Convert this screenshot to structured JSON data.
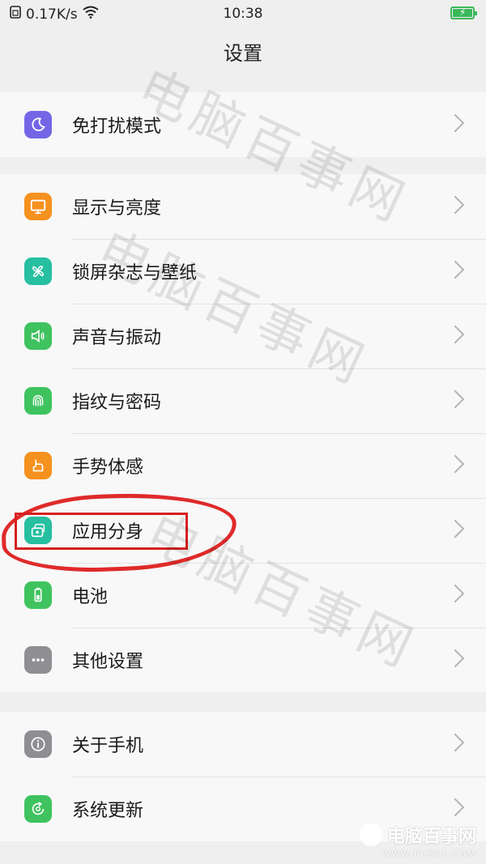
{
  "status_bar": {
    "network_speed": "0.17K/s",
    "time": "10:38"
  },
  "header": {
    "title": "设置"
  },
  "groups": [
    {
      "items": [
        {
          "label": "免打扰模式",
          "icon": "moon-icon",
          "color": "#7266e6"
        }
      ]
    },
    {
      "items": [
        {
          "label": "显示与亮度",
          "icon": "display-icon",
          "color": "#f5911f"
        },
        {
          "label": "锁屏杂志与壁纸",
          "icon": "pinwheel-icon",
          "color": "#26bfa0"
        },
        {
          "label": "声音与振动",
          "icon": "speaker-icon",
          "color": "#3fc35f"
        },
        {
          "label": "指纹与密码",
          "icon": "fingerprint-icon",
          "color": "#3fc35f"
        },
        {
          "label": "手势体感",
          "icon": "gesture-hand-icon",
          "color": "#f5911f"
        },
        {
          "label": "应用分身",
          "icon": "app-clone-icon",
          "color": "#26bfa0"
        },
        {
          "label": "电池",
          "icon": "battery-icon",
          "color": "#3fc35f"
        },
        {
          "label": "其他设置",
          "icon": "more-dots-icon",
          "color": "#8e8e93"
        }
      ]
    },
    {
      "items": [
        {
          "label": "关于手机",
          "icon": "info-icon",
          "color": "#8e8e93"
        },
        {
          "label": "系统更新",
          "icon": "update-icon",
          "color": "#3fc35f"
        }
      ]
    }
  ],
  "watermark": {
    "text": "电脑百事网"
  },
  "brand": {
    "name": "电脑百事网",
    "url": "WWW.PC841.COM"
  }
}
